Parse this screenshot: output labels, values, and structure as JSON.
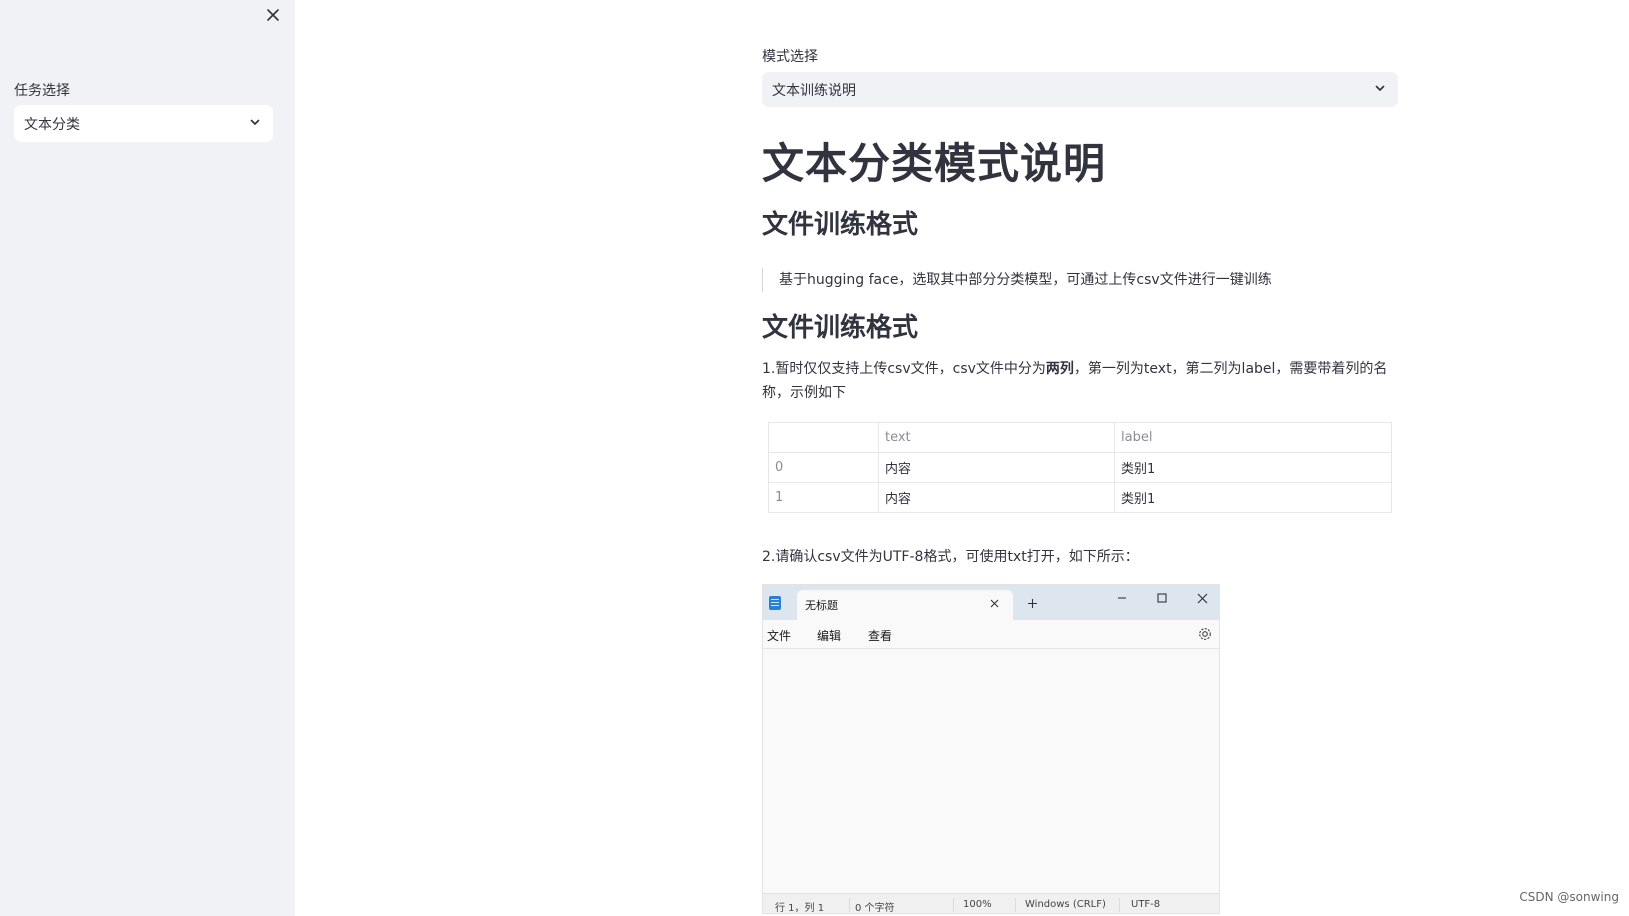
{
  "sidebar": {
    "label": "任务选择",
    "select_value": "文本分类"
  },
  "main": {
    "mode_label": "模式选择",
    "mode_value": "文本训练说明",
    "title": "文本分类模式说明",
    "heading1": "文件训练格式",
    "quote": "基于hugging face，选取其中部分分类模型，可通过上传csv文件进行一键训练",
    "heading2": "文件训练格式",
    "para1_a": "1.暂时仅仅支持上传csv文件，csv文件中分为",
    "para1_bold": "两列",
    "para1_b": "，第一列为text，第二列为label，需要带着列的名称，示例如下",
    "table": {
      "headers": [
        "",
        "text",
        "label"
      ],
      "rows": [
        [
          "0",
          "内容",
          "类别1"
        ],
        [
          "1",
          "内容",
          "类别1"
        ]
      ]
    },
    "para2": "2.请确认csv文件为UTF-8格式，可使用txt打开，如下所示："
  },
  "notepad": {
    "tab_title": "无标题",
    "menu": [
      "文件",
      "编辑",
      "查看"
    ],
    "status": {
      "position": "行 1，列 1",
      "chars": "0 个字符",
      "zoom": "100%",
      "line_ending": "Windows (CRLF)",
      "encoding": "UTF-8"
    }
  },
  "watermark": "CSDN @sonwing",
  "colors": {
    "sidebar_bg": "#f0f2f6",
    "text": "#31333f",
    "select_bg": "#f0f2f6"
  },
  "icons": {
    "sidebar_close": "close-icon",
    "select_arrow": "chevron-down-icon",
    "notepad_app": "notepad-icon",
    "gear": "gear-icon"
  }
}
